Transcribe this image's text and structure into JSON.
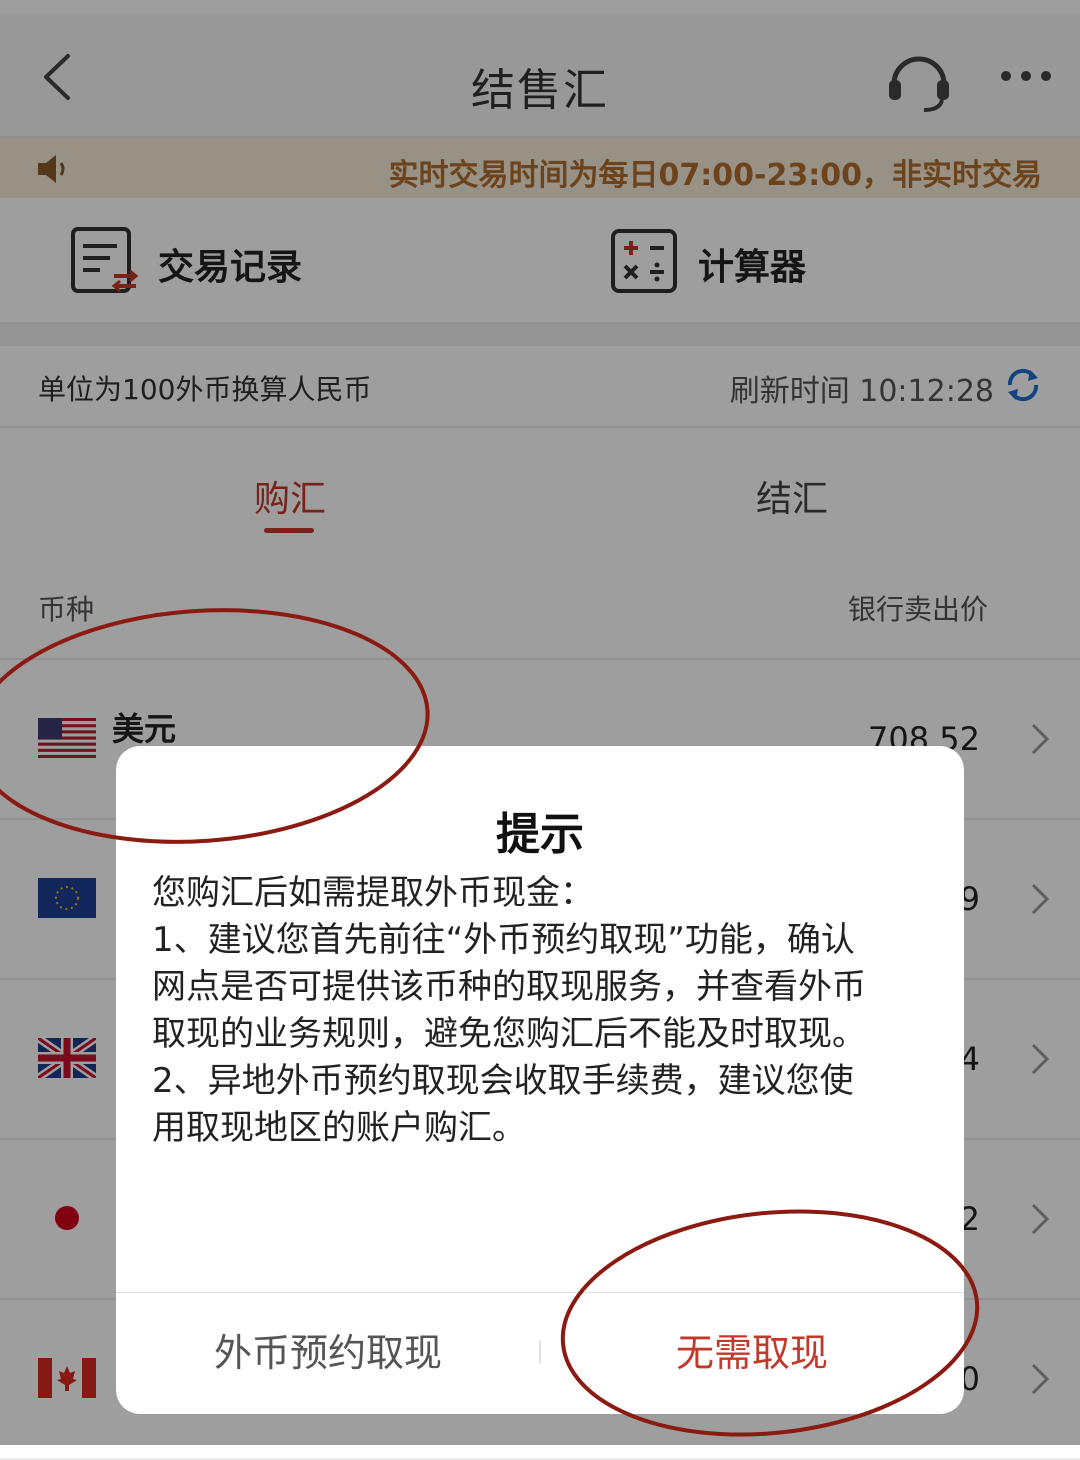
{
  "nav": {
    "title": "结售汇",
    "back_icon": "chevron-left-icon",
    "service_icon": "headset-icon",
    "more_icon": "more-dots-icon"
  },
  "notice": {
    "icon": "speaker-icon",
    "text": "实时交易时间为每日07:00-23:00，非实时交易"
  },
  "tools": [
    {
      "label": "交易记录",
      "icon": "transaction-record-icon"
    },
    {
      "label": "计算器",
      "icon": "calculator-icon"
    }
  ],
  "unit_bar": {
    "unit_text": "单位为100外币换算人民币",
    "refresh_text": "刷新时间 10:12:28",
    "refresh_icon": "refresh-icon"
  },
  "tabs": [
    {
      "label": "购汇",
      "active": true
    },
    {
      "label": "结汇",
      "active": false
    }
  ],
  "table": {
    "col_currency": "币种",
    "col_price": "银行卖出价",
    "rows": [
      {
        "flag": "us-flag-icon",
        "name": "美元",
        "price": "708.52"
      },
      {
        "flag": "eu-flag-icon",
        "name": "",
        "price": "9"
      },
      {
        "flag": "uk-flag-icon",
        "name": "",
        "price": "4"
      },
      {
        "flag": "jp-flag-icon",
        "name": "",
        "price": "2"
      },
      {
        "flag": "ca-flag-icon",
        "name": "",
        "price": "0"
      }
    ]
  },
  "dialog": {
    "title": "提示",
    "body_lines": [
      "您购汇后如需提取外币现金：",
      "1、建议您首先前往“外币预约取现”功能，确认",
      "网点是否可提供该币种的取现服务，并查看外币",
      "取现的业务规则，避免您购汇后不能及时取现。",
      "2、异地外币预约取现会收取手续费，建议您使",
      "用取现地区的账户购汇。"
    ],
    "btn_left": "外币预约取现",
    "btn_right": "无需取现"
  },
  "colors": {
    "accent": "#c0392b",
    "notice_text": "#b16c2e",
    "notice_bg": "#f4ead9",
    "annotation": "#8b1a12"
  }
}
